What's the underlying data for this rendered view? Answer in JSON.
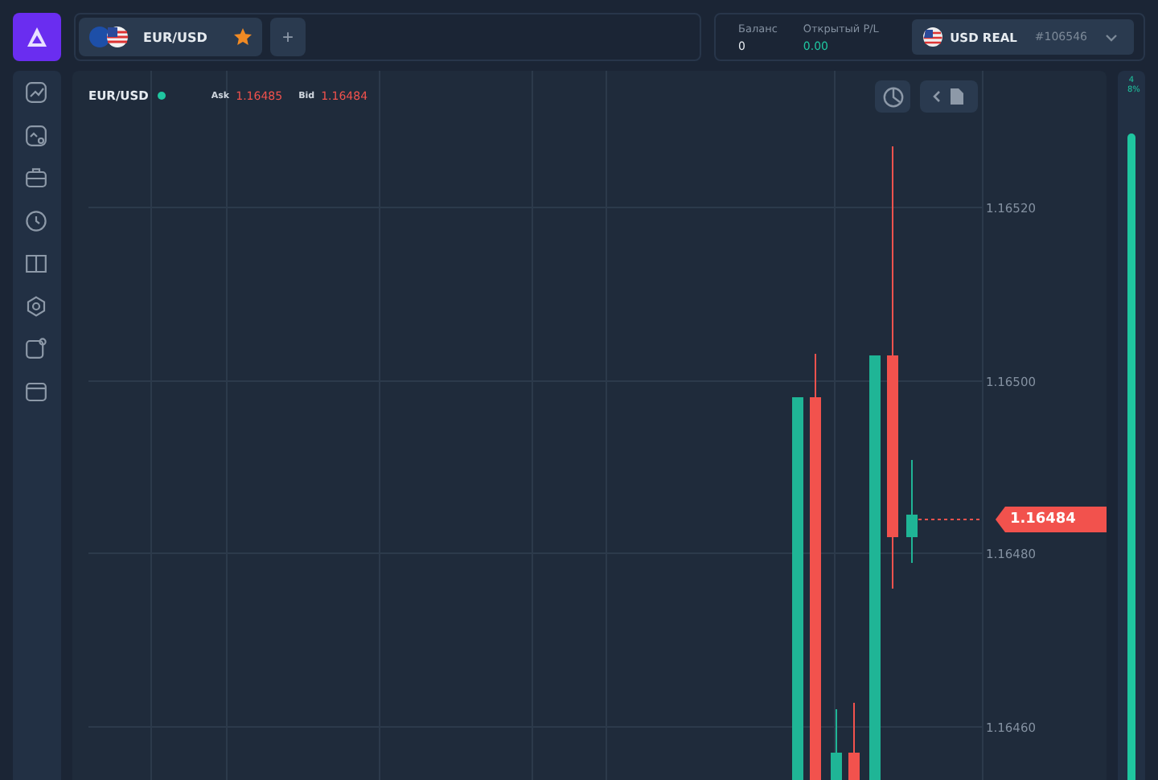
{
  "pair_tabs": [
    {
      "label": "EUR/USD",
      "favorite": true,
      "selected": true
    }
  ],
  "add_tab": "+",
  "balance": {
    "label": "Баланс",
    "value": "0"
  },
  "open_pl": {
    "label": "Открытый P/L",
    "value": "0.00"
  },
  "account": {
    "name": "USD REAL",
    "number": "#106546"
  },
  "chart": {
    "symbol": "EUR/USD",
    "live": true,
    "ask_label": "Ask",
    "ask": "1.16485",
    "bid_label": "Bid",
    "bid": "1.16484",
    "price_labels": [
      "1.16520",
      "1.16500",
      "1.16480",
      "1.16460"
    ],
    "current_price": "1.16484"
  },
  "sentiment": {
    "label": "48%",
    "level": 0.95
  }
}
